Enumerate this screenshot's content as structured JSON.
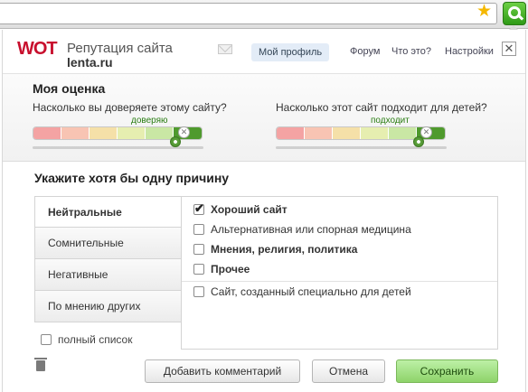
{
  "header": {
    "logo": "WOT",
    "title": "Репутация сайта",
    "site": "lenta.ru",
    "profile_label": "Мой профиль",
    "nav": [
      "Форум",
      "Что это?",
      "Настройки"
    ],
    "close": "✕"
  },
  "rating": {
    "heading": "Моя оценка",
    "trust": {
      "question": "Насколько вы доверяете этому сайту?",
      "verdict": "доверяю",
      "level": 0.85
    },
    "child": {
      "question": "Насколько этот сайт подходит для детей?",
      "verdict": "подходит",
      "level": 0.85
    },
    "scale_colors": [
      "#f4a3a3",
      "#f8c4b3",
      "#f5e0a8",
      "#e6eeb0",
      "#c9e7a4",
      "#4f9a2d"
    ]
  },
  "reasons": {
    "heading": "Укажите хотя бы одну причину",
    "categories": [
      "Нейтральные",
      "Сомнительные",
      "Негативные",
      "По мнению других"
    ],
    "active_category": 0,
    "items": [
      {
        "label": "Хороший сайт",
        "checked": true,
        "bold": true
      },
      {
        "label": "Альтернативная или спорная медицина",
        "checked": false,
        "bold": false
      },
      {
        "label": "Мнения, религия, политика",
        "checked": false,
        "bold": true
      },
      {
        "label": "Прочее",
        "checked": false,
        "bold": true
      },
      {
        "label": "Сайт, созданный специально для детей",
        "checked": false,
        "bold": false
      }
    ],
    "full_list_label": "полный список"
  },
  "buttons": {
    "comment": "Добавить комментарий",
    "cancel": "Отмена",
    "save": "Сохранить"
  }
}
